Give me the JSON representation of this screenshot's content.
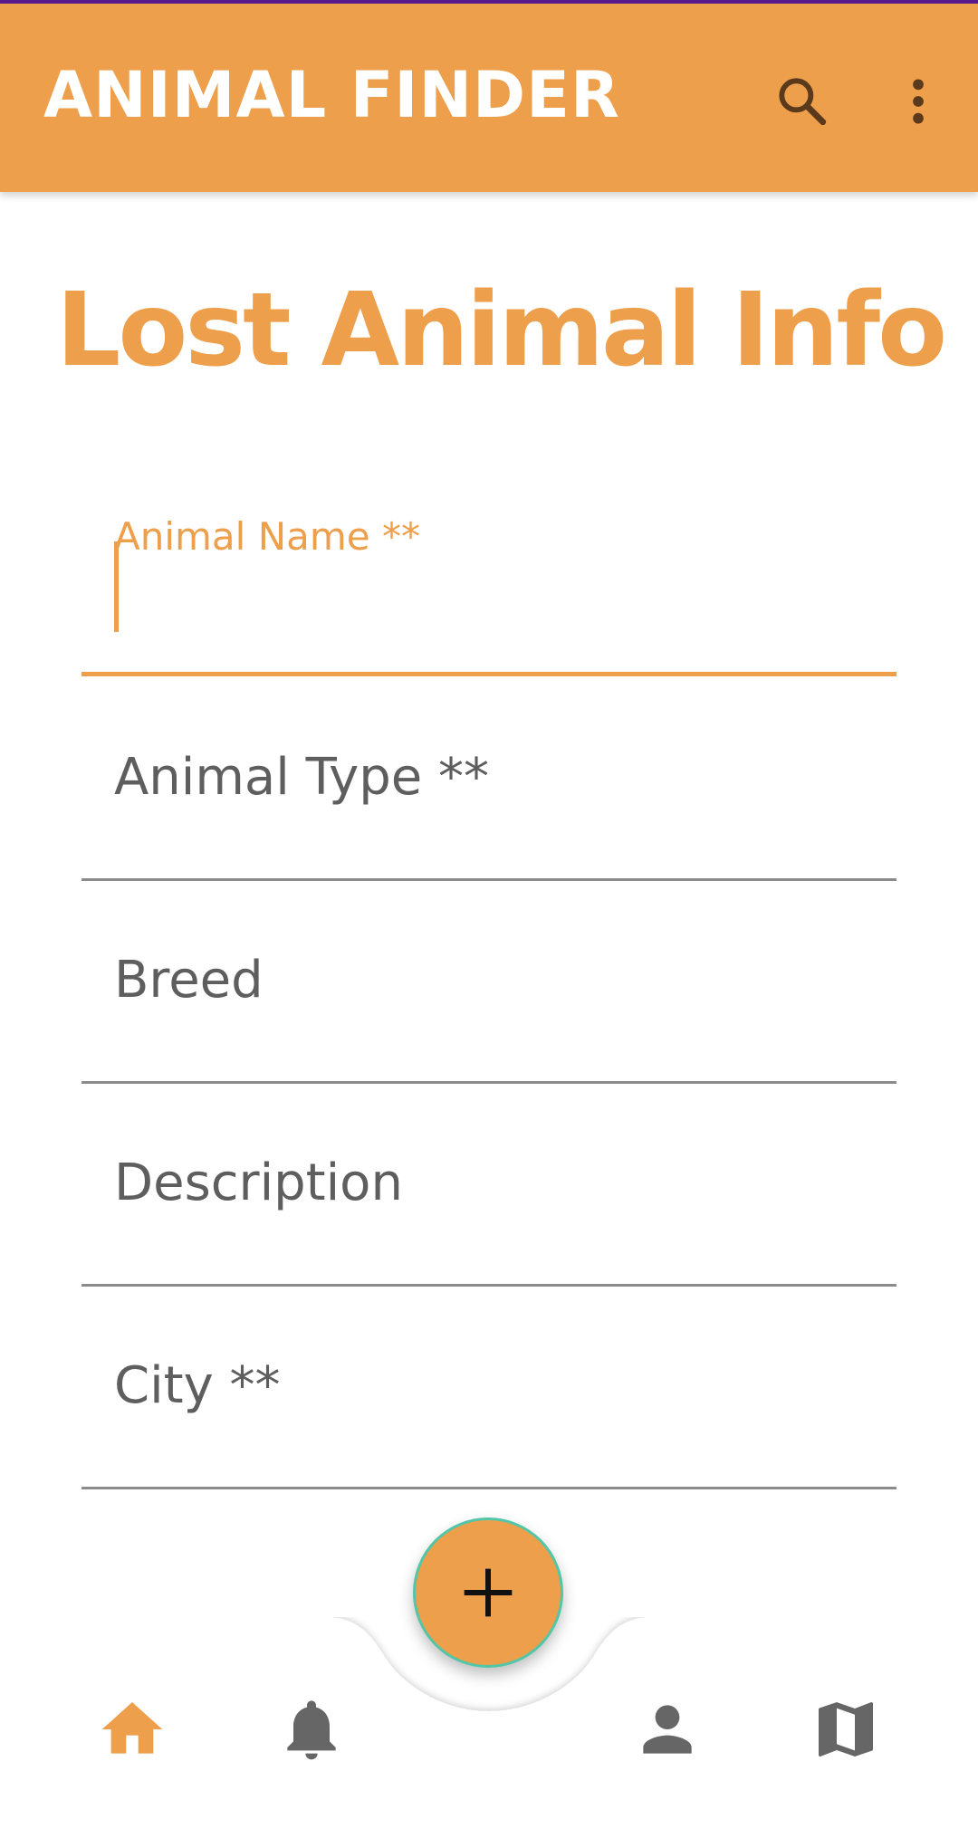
{
  "app_bar": {
    "title": "ANIMAL FINDER",
    "icons": [
      "search-icon",
      "more-vert-icon"
    ]
  },
  "page": {
    "title": "Lost Animal Info"
  },
  "form": {
    "fields": [
      {
        "label": "Animal Name **",
        "value": "",
        "state": "focused"
      },
      {
        "label": "Animal Type **",
        "value": ""
      },
      {
        "label": "Breed",
        "value": ""
      },
      {
        "label": "Description",
        "value": ""
      },
      {
        "label": "City **",
        "value": ""
      }
    ]
  },
  "bottom_nav": {
    "items": [
      {
        "icon": "home-icon",
        "active": true
      },
      {
        "icon": "bell-icon",
        "active": false
      },
      {
        "icon": "person-icon",
        "active": false
      },
      {
        "icon": "map-icon",
        "active": false
      }
    ],
    "fab_icon": "plus-icon"
  },
  "colors": {
    "accent": "#ed9f4b",
    "text_secondary": "#5e5e5e",
    "divider": "#8a8a8a",
    "icon_dark": "#5b3a1c",
    "fab_border": "#53c6a8"
  }
}
